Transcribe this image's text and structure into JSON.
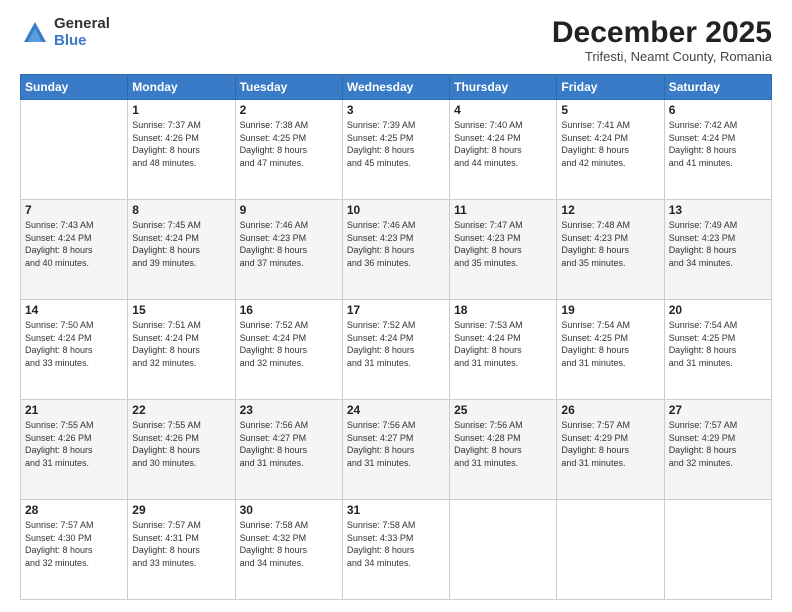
{
  "logo": {
    "general": "General",
    "blue": "Blue"
  },
  "header": {
    "month": "December 2025",
    "location": "Trifesti, Neamt County, Romania"
  },
  "weekdays": [
    "Sunday",
    "Monday",
    "Tuesday",
    "Wednesday",
    "Thursday",
    "Friday",
    "Saturday"
  ],
  "weeks": [
    [
      {
        "day": "",
        "info": ""
      },
      {
        "day": "1",
        "info": "Sunrise: 7:37 AM\nSunset: 4:26 PM\nDaylight: 8 hours\nand 48 minutes."
      },
      {
        "day": "2",
        "info": "Sunrise: 7:38 AM\nSunset: 4:25 PM\nDaylight: 8 hours\nand 47 minutes."
      },
      {
        "day": "3",
        "info": "Sunrise: 7:39 AM\nSunset: 4:25 PM\nDaylight: 8 hours\nand 45 minutes."
      },
      {
        "day": "4",
        "info": "Sunrise: 7:40 AM\nSunset: 4:24 PM\nDaylight: 8 hours\nand 44 minutes."
      },
      {
        "day": "5",
        "info": "Sunrise: 7:41 AM\nSunset: 4:24 PM\nDaylight: 8 hours\nand 42 minutes."
      },
      {
        "day": "6",
        "info": "Sunrise: 7:42 AM\nSunset: 4:24 PM\nDaylight: 8 hours\nand 41 minutes."
      }
    ],
    [
      {
        "day": "7",
        "info": "Sunrise: 7:43 AM\nSunset: 4:24 PM\nDaylight: 8 hours\nand 40 minutes."
      },
      {
        "day": "8",
        "info": "Sunrise: 7:45 AM\nSunset: 4:24 PM\nDaylight: 8 hours\nand 39 minutes."
      },
      {
        "day": "9",
        "info": "Sunrise: 7:46 AM\nSunset: 4:23 PM\nDaylight: 8 hours\nand 37 minutes."
      },
      {
        "day": "10",
        "info": "Sunrise: 7:46 AM\nSunset: 4:23 PM\nDaylight: 8 hours\nand 36 minutes."
      },
      {
        "day": "11",
        "info": "Sunrise: 7:47 AM\nSunset: 4:23 PM\nDaylight: 8 hours\nand 35 minutes."
      },
      {
        "day": "12",
        "info": "Sunrise: 7:48 AM\nSunset: 4:23 PM\nDaylight: 8 hours\nand 35 minutes."
      },
      {
        "day": "13",
        "info": "Sunrise: 7:49 AM\nSunset: 4:23 PM\nDaylight: 8 hours\nand 34 minutes."
      }
    ],
    [
      {
        "day": "14",
        "info": "Sunrise: 7:50 AM\nSunset: 4:24 PM\nDaylight: 8 hours\nand 33 minutes."
      },
      {
        "day": "15",
        "info": "Sunrise: 7:51 AM\nSunset: 4:24 PM\nDaylight: 8 hours\nand 32 minutes."
      },
      {
        "day": "16",
        "info": "Sunrise: 7:52 AM\nSunset: 4:24 PM\nDaylight: 8 hours\nand 32 minutes."
      },
      {
        "day": "17",
        "info": "Sunrise: 7:52 AM\nSunset: 4:24 PM\nDaylight: 8 hours\nand 31 minutes."
      },
      {
        "day": "18",
        "info": "Sunrise: 7:53 AM\nSunset: 4:24 PM\nDaylight: 8 hours\nand 31 minutes."
      },
      {
        "day": "19",
        "info": "Sunrise: 7:54 AM\nSunset: 4:25 PM\nDaylight: 8 hours\nand 31 minutes."
      },
      {
        "day": "20",
        "info": "Sunrise: 7:54 AM\nSunset: 4:25 PM\nDaylight: 8 hours\nand 31 minutes."
      }
    ],
    [
      {
        "day": "21",
        "info": "Sunrise: 7:55 AM\nSunset: 4:26 PM\nDaylight: 8 hours\nand 31 minutes."
      },
      {
        "day": "22",
        "info": "Sunrise: 7:55 AM\nSunset: 4:26 PM\nDaylight: 8 hours\nand 30 minutes."
      },
      {
        "day": "23",
        "info": "Sunrise: 7:56 AM\nSunset: 4:27 PM\nDaylight: 8 hours\nand 31 minutes."
      },
      {
        "day": "24",
        "info": "Sunrise: 7:56 AM\nSunset: 4:27 PM\nDaylight: 8 hours\nand 31 minutes."
      },
      {
        "day": "25",
        "info": "Sunrise: 7:56 AM\nSunset: 4:28 PM\nDaylight: 8 hours\nand 31 minutes."
      },
      {
        "day": "26",
        "info": "Sunrise: 7:57 AM\nSunset: 4:29 PM\nDaylight: 8 hours\nand 31 minutes."
      },
      {
        "day": "27",
        "info": "Sunrise: 7:57 AM\nSunset: 4:29 PM\nDaylight: 8 hours\nand 32 minutes."
      }
    ],
    [
      {
        "day": "28",
        "info": "Sunrise: 7:57 AM\nSunset: 4:30 PM\nDaylight: 8 hours\nand 32 minutes."
      },
      {
        "day": "29",
        "info": "Sunrise: 7:57 AM\nSunset: 4:31 PM\nDaylight: 8 hours\nand 33 minutes."
      },
      {
        "day": "30",
        "info": "Sunrise: 7:58 AM\nSunset: 4:32 PM\nDaylight: 8 hours\nand 34 minutes."
      },
      {
        "day": "31",
        "info": "Sunrise: 7:58 AM\nSunset: 4:33 PM\nDaylight: 8 hours\nand 34 minutes."
      },
      {
        "day": "",
        "info": ""
      },
      {
        "day": "",
        "info": ""
      },
      {
        "day": "",
        "info": ""
      }
    ]
  ]
}
